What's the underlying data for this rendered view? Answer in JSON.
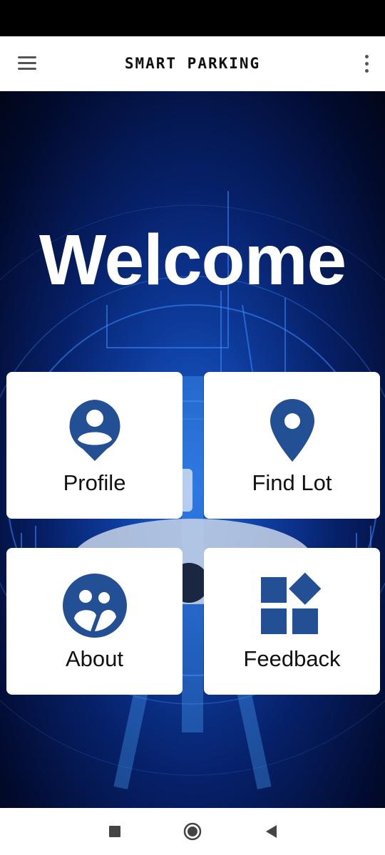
{
  "app_bar": {
    "title": "SMART PARKING",
    "menu_icon": "hamburger-menu-icon",
    "overflow_icon": "more-vert-icon"
  },
  "hero": {
    "welcome": "Welcome"
  },
  "cards": [
    {
      "label": "Profile",
      "icon": "profile-icon"
    },
    {
      "label": "Find Lot",
      "icon": "location-pin-icon"
    },
    {
      "label": "About",
      "icon": "people-icon"
    },
    {
      "label": "Feedback",
      "icon": "blocks-icon"
    }
  ],
  "nav": {
    "recents_icon": "square-icon",
    "home_icon": "circle-icon",
    "back_icon": "triangle-back-icon"
  },
  "colors": {
    "accent": "#234f95",
    "app_bar": "#ffffff",
    "hero_dark": "#020b2e",
    "hero_light": "#1e63d6"
  }
}
